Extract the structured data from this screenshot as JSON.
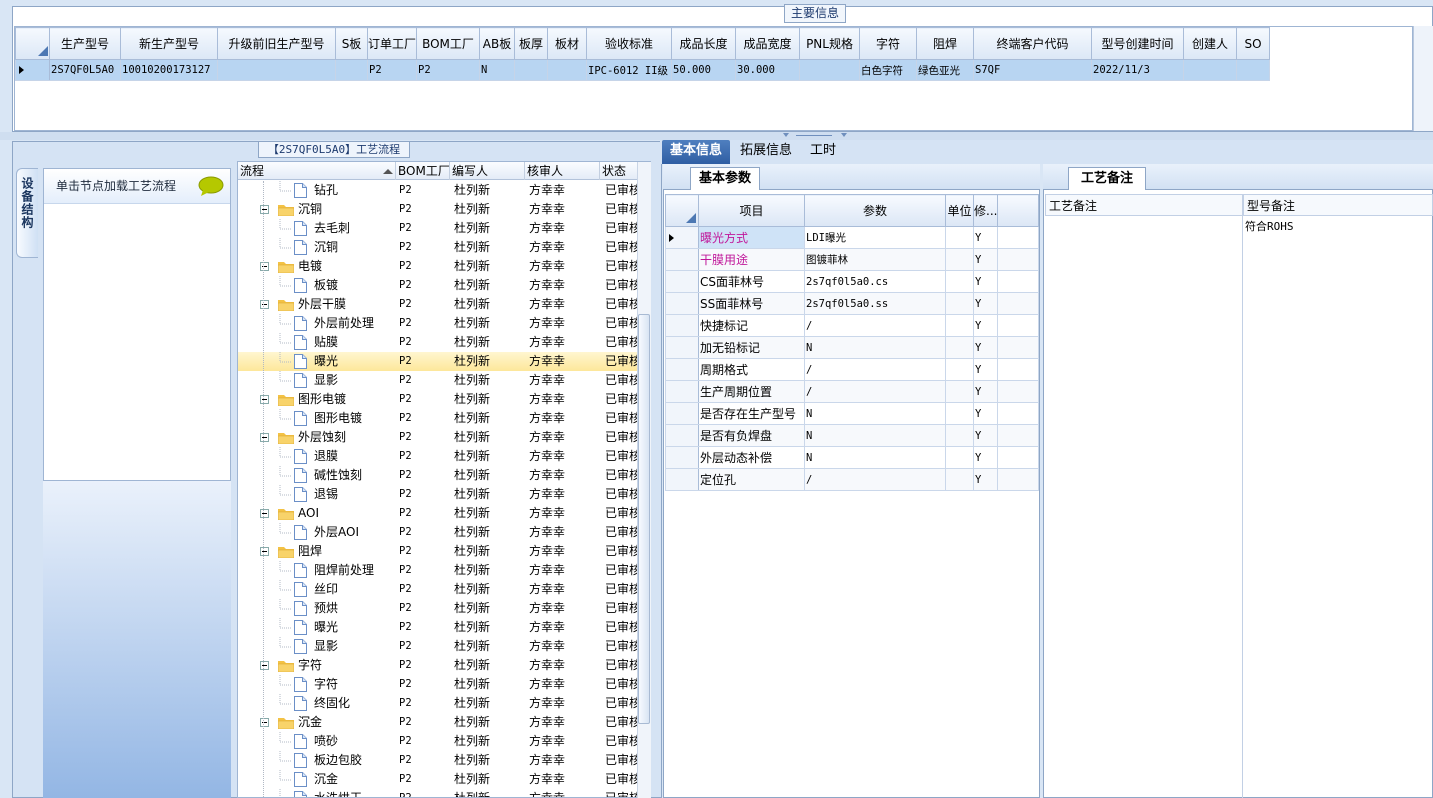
{
  "main_info": {
    "title": "主要信息",
    "columns": [
      "生产型号",
      "新生产型号",
      "升级前旧生产型号",
      "S板",
      "订单工厂",
      "BOM工厂",
      "AB板",
      "板厚",
      "板材",
      "验收标准",
      "成品长度",
      "成品宽度",
      "PNL规格",
      "字符",
      "阻焊",
      "终端客户代码",
      "型号创建时间",
      "创建人",
      "SO"
    ],
    "rows": [
      [
        "2S7QF0L5A0",
        "10010200173127",
        "",
        "",
        "P2",
        "P2",
        "N",
        "",
        "",
        "IPC-6012 II级",
        "50.000",
        "30.000",
        "",
        "白色字符",
        "绿色亚光",
        "S7QF",
        "2022/11/3",
        "",
        ""
      ]
    ]
  },
  "process": {
    "title": "【2S7QF0L5A0】工艺流程",
    "side_tab": "设备结构",
    "hint": "单击节点加载工艺流程",
    "columns": [
      "流程",
      "BOM工厂",
      "编写人",
      "核审人",
      "状态"
    ],
    "rows": [
      {
        "name": "钻孔",
        "level": 1,
        "factory": "P2",
        "writer": "杜列新",
        "reviewer": "方幸幸",
        "status": "已审核"
      },
      {
        "name": "沉铜",
        "level": 0,
        "factory": "P2",
        "writer": "杜列新",
        "reviewer": "方幸幸",
        "status": "已审核"
      },
      {
        "name": "去毛刺",
        "level": 1,
        "factory": "P2",
        "writer": "杜列新",
        "reviewer": "方幸幸",
        "status": "已审核"
      },
      {
        "name": "沉铜",
        "level": 1,
        "factory": "P2",
        "writer": "杜列新",
        "reviewer": "方幸幸",
        "status": "已审核"
      },
      {
        "name": "电镀",
        "level": 0,
        "factory": "P2",
        "writer": "杜列新",
        "reviewer": "方幸幸",
        "status": "已审核"
      },
      {
        "name": "板镀",
        "level": 1,
        "factory": "P2",
        "writer": "杜列新",
        "reviewer": "方幸幸",
        "status": "已审核"
      },
      {
        "name": "外层干膜",
        "level": 0,
        "factory": "P2",
        "writer": "杜列新",
        "reviewer": "方幸幸",
        "status": "已审核"
      },
      {
        "name": "外层前处理",
        "level": 1,
        "factory": "P2",
        "writer": "杜列新",
        "reviewer": "方幸幸",
        "status": "已审核"
      },
      {
        "name": "贴膜",
        "level": 1,
        "factory": "P2",
        "writer": "杜列新",
        "reviewer": "方幸幸",
        "status": "已审核"
      },
      {
        "name": "曝光",
        "level": 1,
        "factory": "P2",
        "writer": "杜列新",
        "reviewer": "方幸幸",
        "status": "已审核",
        "selected": true
      },
      {
        "name": "显影",
        "level": 1,
        "factory": "P2",
        "writer": "杜列新",
        "reviewer": "方幸幸",
        "status": "已审核"
      },
      {
        "name": "图形电镀",
        "level": 0,
        "factory": "P2",
        "writer": "杜列新",
        "reviewer": "方幸幸",
        "status": "已审核"
      },
      {
        "name": "图形电镀",
        "level": 1,
        "factory": "P2",
        "writer": "杜列新",
        "reviewer": "方幸幸",
        "status": "已审核"
      },
      {
        "name": "外层蚀刻",
        "level": 0,
        "factory": "P2",
        "writer": "杜列新",
        "reviewer": "方幸幸",
        "status": "已审核"
      },
      {
        "name": "退膜",
        "level": 1,
        "factory": "P2",
        "writer": "杜列新",
        "reviewer": "方幸幸",
        "status": "已审核"
      },
      {
        "name": "碱性蚀刻",
        "level": 1,
        "factory": "P2",
        "writer": "杜列新",
        "reviewer": "方幸幸",
        "status": "已审核"
      },
      {
        "name": "退锡",
        "level": 1,
        "factory": "P2",
        "writer": "杜列新",
        "reviewer": "方幸幸",
        "status": "已审核"
      },
      {
        "name": "AOI",
        "level": 0,
        "factory": "P2",
        "writer": "杜列新",
        "reviewer": "方幸幸",
        "status": "已审核"
      },
      {
        "name": "外层AOI",
        "level": 1,
        "factory": "P2",
        "writer": "杜列新",
        "reviewer": "方幸幸",
        "status": "已审核"
      },
      {
        "name": "阻焊",
        "level": 0,
        "factory": "P2",
        "writer": "杜列新",
        "reviewer": "方幸幸",
        "status": "已审核"
      },
      {
        "name": "阻焊前处理",
        "level": 1,
        "factory": "P2",
        "writer": "杜列新",
        "reviewer": "方幸幸",
        "status": "已审核"
      },
      {
        "name": "丝印",
        "level": 1,
        "factory": "P2",
        "writer": "杜列新",
        "reviewer": "方幸幸",
        "status": "已审核"
      },
      {
        "name": "预烘",
        "level": 1,
        "factory": "P2",
        "writer": "杜列新",
        "reviewer": "方幸幸",
        "status": "已审核"
      },
      {
        "name": "曝光",
        "level": 1,
        "factory": "P2",
        "writer": "杜列新",
        "reviewer": "方幸幸",
        "status": "已审核"
      },
      {
        "name": "显影",
        "level": 1,
        "factory": "P2",
        "writer": "杜列新",
        "reviewer": "方幸幸",
        "status": "已审核"
      },
      {
        "name": "字符",
        "level": 0,
        "factory": "P2",
        "writer": "杜列新",
        "reviewer": "方幸幸",
        "status": "已审核"
      },
      {
        "name": "字符",
        "level": 1,
        "factory": "P2",
        "writer": "杜列新",
        "reviewer": "方幸幸",
        "status": "已审核"
      },
      {
        "name": "终固化",
        "level": 1,
        "factory": "P2",
        "writer": "杜列新",
        "reviewer": "方幸幸",
        "status": "已审核"
      },
      {
        "name": "沉金",
        "level": 0,
        "factory": "P2",
        "writer": "杜列新",
        "reviewer": "方幸幸",
        "status": "已审核"
      },
      {
        "name": "喷砂",
        "level": 1,
        "factory": "P2",
        "writer": "杜列新",
        "reviewer": "方幸幸",
        "status": "已审核"
      },
      {
        "name": "板边包胶",
        "level": 1,
        "factory": "P2",
        "writer": "杜列新",
        "reviewer": "方幸幸",
        "status": "已审核"
      },
      {
        "name": "沉金",
        "level": 1,
        "factory": "P2",
        "writer": "杜列新",
        "reviewer": "方幸幸",
        "status": "已审核"
      },
      {
        "name": "水洗烘干",
        "level": 1,
        "factory": "P2",
        "writer": "杜列新",
        "reviewer": "方幸幸",
        "status": "已审核"
      }
    ]
  },
  "tabs": [
    "基本信息",
    "拓展信息",
    "工时"
  ],
  "basic_params": {
    "title": "基本参数",
    "columns": [
      "项目",
      "参数",
      "单位",
      "修..."
    ],
    "rows": [
      {
        "item": "曝光方式",
        "value": "LDI曝光",
        "unit": "",
        "mod": "Y",
        "highlight": true
      },
      {
        "item": "干膜用途",
        "value": "图镀菲林",
        "unit": "",
        "mod": "Y",
        "highlight": true
      },
      {
        "item": "CS面菲林号",
        "value": "2s7qf0l5a0.cs",
        "unit": "",
        "mod": "Y"
      },
      {
        "item": "SS面菲林号",
        "value": "2s7qf0l5a0.ss",
        "unit": "",
        "mod": "Y"
      },
      {
        "item": "快捷标记",
        "value": "/",
        "unit": "",
        "mod": "Y"
      },
      {
        "item": "加无铅标记",
        "value": "N",
        "unit": "",
        "mod": "Y"
      },
      {
        "item": "周期格式",
        "value": "/",
        "unit": "",
        "mod": "Y"
      },
      {
        "item": "生产周期位置",
        "value": "/",
        "unit": "",
        "mod": "Y"
      },
      {
        "item": "是否存在生产型号",
        "value": "N",
        "unit": "",
        "mod": "Y"
      },
      {
        "item": "是否有负焊盘",
        "value": "N",
        "unit": "",
        "mod": "Y"
      },
      {
        "item": "外层动态补偿",
        "value": "N",
        "unit": "",
        "mod": "Y"
      },
      {
        "item": "定位孔",
        "value": "/",
        "unit": "",
        "mod": "Y"
      }
    ]
  },
  "remarks": {
    "title": "工艺备注",
    "process_remark_label": "工艺备注",
    "model_remark_label": "型号备注",
    "model_remark_value": "符合ROHS"
  },
  "colors": {
    "accent": "#2f5ea3",
    "pink": "#c0179a",
    "selection": "#b8d5f2"
  },
  "icons": [
    "folder-icon",
    "document-icon",
    "speech-bubble-icon",
    "row-pointer-icon",
    "collapse-icon"
  ]
}
